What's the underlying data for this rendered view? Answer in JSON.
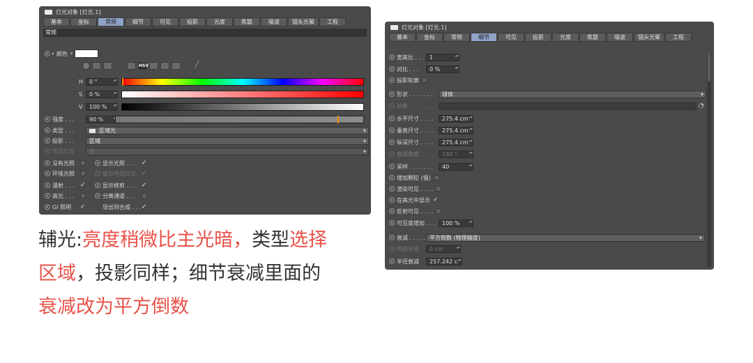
{
  "panel1": {
    "title": "灯光对象 [灯光.1]",
    "tabs": [
      "基本",
      "坐标",
      "常规",
      "细节",
      "可见",
      "投影",
      "光度",
      "焦散",
      "噪波",
      "镜头光晕",
      "工程"
    ],
    "active_tab": 2,
    "section": "常规",
    "color_label": "颜色",
    "color_value": "#ffffff",
    "hsv_icon": "HSV",
    "h_label": "H",
    "h_value": "0 °",
    "s_label": "S",
    "s_value": "0 %",
    "v_label": "V",
    "v_value": "100 %",
    "intensity_label": "强度 . . .",
    "intensity_value": "90 %",
    "intensity_fraction": 0.9,
    "type_label": "类型 . . .",
    "type_value": "区域光",
    "shadow_label": "投影 . . .",
    "shadow_value": "区域",
    "visible_label": "可见灯光",
    "visible_value": "无",
    "checks_left": [
      {
        "label": "没有光照",
        "checked": false
      },
      {
        "label": "环境光照",
        "checked": false
      },
      {
        "label": "漫射 . . .",
        "checked": true
      },
      {
        "label": "高光 . . .",
        "checked": false
      },
      {
        "label": "GI 照明",
        "checked": true
      }
    ],
    "checks_right": [
      {
        "label": "显示光照 . . .",
        "checked": true
      },
      {
        "label": "显示可见灯光",
        "checked": true,
        "dim": true
      },
      {
        "label": "显示修剪 . . .",
        "checked": true
      },
      {
        "label": "分离通道 . . .",
        "checked": false
      },
      {
        "label": "导出到合成 . . .",
        "checked": true
      }
    ],
    "check_mark": "✓"
  },
  "panel2": {
    "title": "灯光对象 [灯光.1]",
    "tabs": [
      "基本",
      "坐标",
      "常规",
      "细节",
      "可见",
      "投影",
      "光度",
      "焦散",
      "噪波",
      "镜头光晕",
      "工程"
    ],
    "active_tab": 3,
    "aspect_label": "宽高比 . . .",
    "aspect_value": "1",
    "contrast_label": "对比 . . .",
    "contrast_value": "0 %",
    "shadow_caster_label": "投影轮廓",
    "shape_label": "形状 . . . . . . .",
    "shape_value": "球体",
    "object_label": "对象 . . . . . . .",
    "hsize_label": "水平尺寸 . . . .",
    "hsize_value": "275.4 cm",
    "vsize_label": "垂直尺寸 . . . .",
    "vsize_value": "275.4 cm",
    "dsize_label": "纵深尺寸 . . . .",
    "dsize_value": "275.4 cm",
    "falloff_angle_label": "衰减角度 . . . .",
    "falloff_angle_value": "180 °",
    "samples_label": "采样 . . . . . . .",
    "samples_value": "40",
    "grain_label": "增加颗粒 (慢)",
    "render_visible_label": "渲染可见 . . . .",
    "show_specular_label": "在高光中显示",
    "show_specular_check": "✓",
    "reflect_visible_label": "反射可见 . . . .",
    "visibility_inc_label": "可见度增加 . . .",
    "visibility_inc_value": "100 %",
    "falloff_label": "衰减 . . . . . . .",
    "falloff_value": "平方倒数 (物理精度)",
    "inner_radius_label": "内部半径",
    "inner_radius_value": "0 cm",
    "radius_falloff_label": "半径衰减",
    "radius_falloff_value": "257.242 c"
  },
  "caption": {
    "line1_a": "辅光:",
    "line1_b": "亮度稍微比主光暗，",
    "line1_c": "类型",
    "line1_d": "选择",
    "line2_a": "区域",
    "line2_b": "，投影同样；细节衰减里面的",
    "line3_a": "衰减改为平方倒数",
    "accent_color": "#e8524a"
  }
}
